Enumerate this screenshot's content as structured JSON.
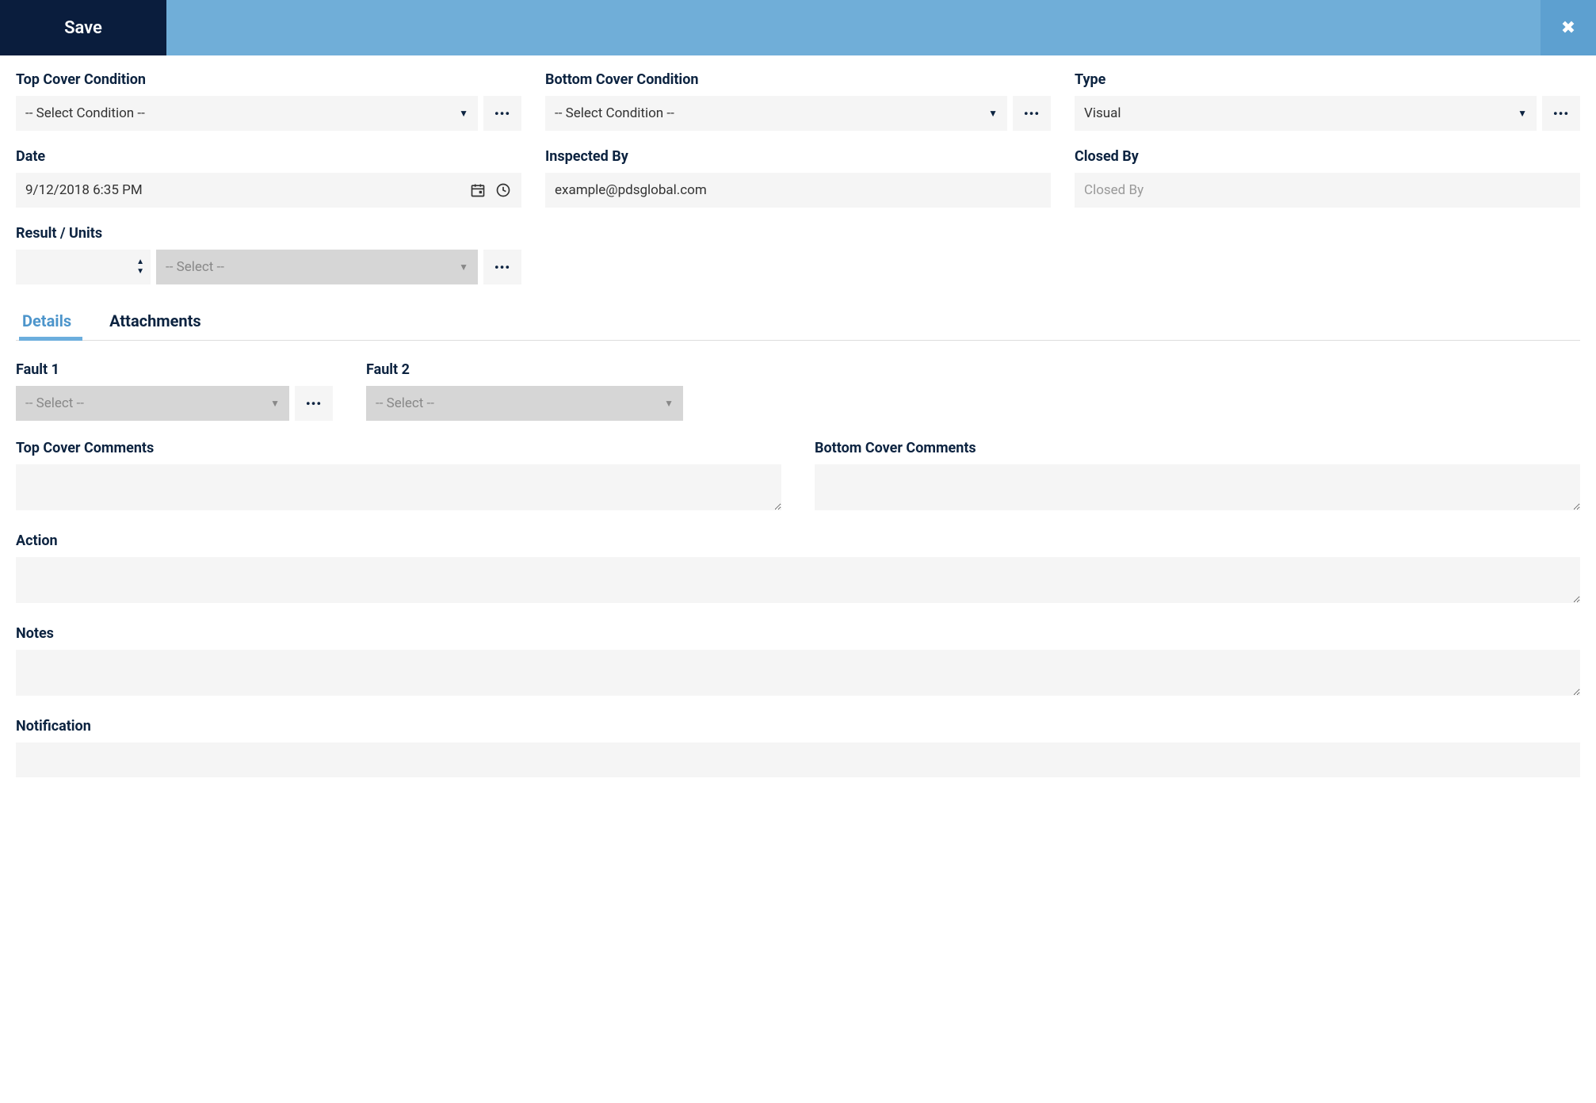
{
  "header": {
    "save_label": "Save"
  },
  "fields": {
    "top_cover_condition": {
      "label": "Top Cover Condition",
      "value": "-- Select Condition --"
    },
    "bottom_cover_condition": {
      "label": "Bottom Cover Condition",
      "value": "-- Select Condition --"
    },
    "type": {
      "label": "Type",
      "value": "Visual"
    },
    "date": {
      "label": "Date",
      "value": "9/12/2018 6:35 PM"
    },
    "inspected_by": {
      "label": "Inspected By",
      "value": "example@pdsglobal.com"
    },
    "closed_by": {
      "label": "Closed By",
      "placeholder": "Closed By"
    },
    "result_units": {
      "label": "Result / Units",
      "units_value": "-- Select --"
    }
  },
  "tabs": {
    "details": "Details",
    "attachments": "Attachments"
  },
  "details": {
    "fault1": {
      "label": "Fault 1",
      "value": "-- Select --"
    },
    "fault2": {
      "label": "Fault 2",
      "value": "-- Select --"
    },
    "top_cover_comments": {
      "label": "Top Cover Comments"
    },
    "bottom_cover_comments": {
      "label": "Bottom Cover Comments"
    },
    "action": {
      "label": "Action"
    },
    "notes": {
      "label": "Notes"
    },
    "notification": {
      "label": "Notification"
    }
  }
}
